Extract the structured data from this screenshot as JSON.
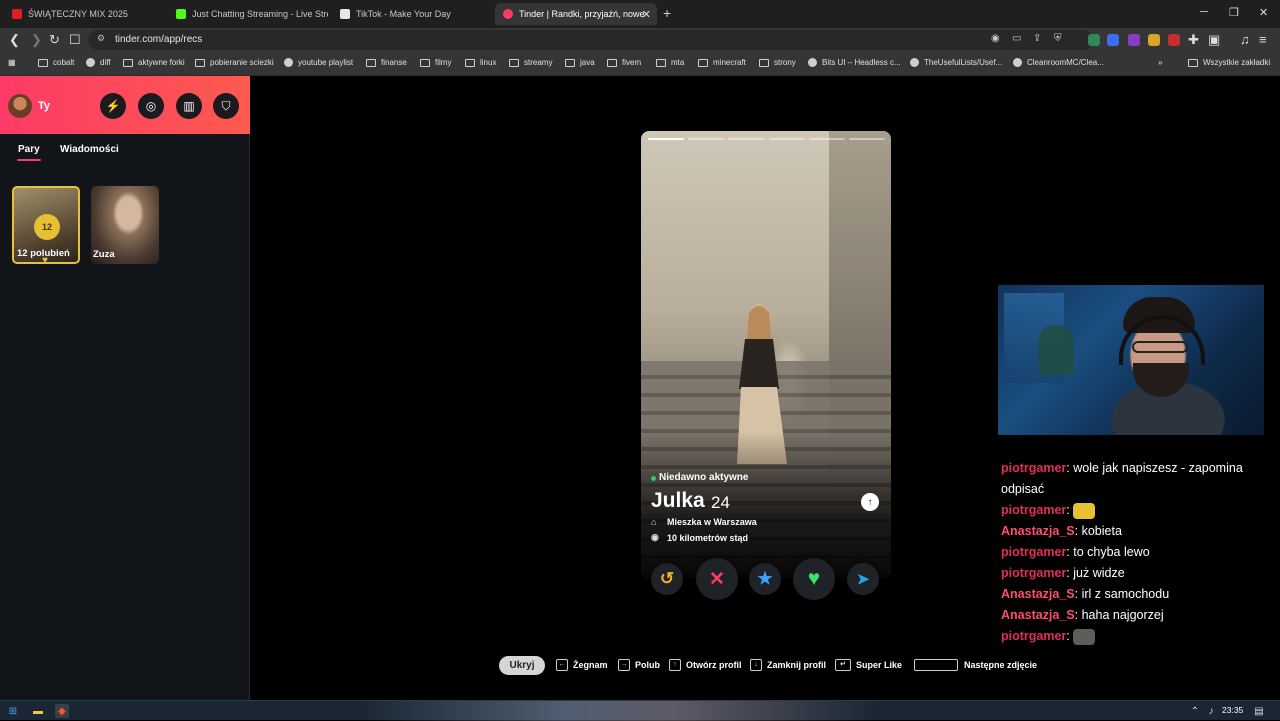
{
  "browser": {
    "tabs": [
      {
        "title": "ŚWIĄTECZNY MIX 2025",
        "fav_color": "#e02020",
        "active": false
      },
      {
        "title": "Just Chatting Streaming - Live Stream",
        "fav_color": "#53fc18",
        "active": false
      },
      {
        "title": "TikTok - Make Your Day",
        "fav_color": "#e8e8e8",
        "active": false
      },
      {
        "title": "Tinder | Randki, przyjaźń, nowe z",
        "fav_color": "#fd3a68",
        "active": true
      }
    ],
    "new_tab": "+",
    "window_controls": {
      "minimize": "─",
      "restore": "❐",
      "close": "✕"
    },
    "url": "tinder.com/app/recs",
    "bookmarks": [
      {
        "label": "cobalt",
        "icon": "cobalt-icon"
      },
      {
        "label": "diff",
        "icon": "diff-icon"
      },
      {
        "label": "aktywne forki",
        "icon": "fork-icon"
      },
      {
        "label": "pobieranie sciezki",
        "icon": "download-icon"
      },
      {
        "label": "youtube playlist",
        "icon": "globe-icon"
      },
      {
        "label": "finanse",
        "icon": "folder-icon"
      },
      {
        "label": "filmy",
        "icon": "folder-icon"
      },
      {
        "label": "linux",
        "icon": "folder-icon"
      },
      {
        "label": "streamy",
        "icon": "folder-icon"
      },
      {
        "label": "java",
        "icon": "folder-icon"
      },
      {
        "label": "fivem",
        "icon": "folder-icon"
      },
      {
        "label": "mta",
        "icon": "folder-icon"
      },
      {
        "label": "minecraft",
        "icon": "folder-icon"
      },
      {
        "label": "strony",
        "icon": "folder-icon"
      },
      {
        "label": "Bits UI – Headless c...",
        "icon": "dot-icon"
      },
      {
        "label": "TheUsefulLists/Usef...",
        "icon": "github-icon"
      },
      {
        "label": "CleanroomMC/Clea...",
        "icon": "github-icon"
      }
    ],
    "bookmarks_more": "»",
    "all_bookmarks": "Wszystkie zakładki"
  },
  "sidebar": {
    "me_label": "Ty",
    "tabs": {
      "matches": "Pary",
      "messages": "Wiadomości"
    },
    "likes": {
      "count": "12",
      "label": "12 polubień"
    },
    "matches": [
      {
        "name": "Zuza"
      }
    ]
  },
  "profile": {
    "status": "Niedawno aktywne",
    "name": "Julka",
    "age": "24",
    "lives_in": "Mieszka w Warszawa",
    "distance": "10 kilometrów stąd",
    "photo_count": 6,
    "current_photo": 1
  },
  "actions": {
    "rewind": "↺",
    "nope": "✕",
    "super_like": "★",
    "like": "♥",
    "boost": "➤"
  },
  "shortcuts": {
    "hide": "Ukryj",
    "nope": "Żegnam",
    "like": "Polub",
    "open_profile": "Otwórz profil",
    "close_profile": "Zamknij profil",
    "super_like": "Super Like",
    "next_photo": "Następne zdjęcie"
  },
  "chat": [
    {
      "user": "piotrgamer",
      "color": "#e0305a",
      "text": "wole jak napiszesz - zapomina"
    },
    {
      "user": "",
      "color": "#e0305a",
      "text": "odpisać"
    },
    {
      "user": "piotrgamer",
      "color": "#e0305a",
      "text": "",
      "emote": "#e7c133"
    },
    {
      "user": "Anastazja_S",
      "color": "#ff4d6d",
      "text": "kobieta"
    },
    {
      "user": "piotrgamer",
      "color": "#e0305a",
      "text": "to chyba lewo"
    },
    {
      "user": "piotrgamer",
      "color": "#e0305a",
      "text": "już widze"
    },
    {
      "user": "Anastazja_S",
      "color": "#ff4d6d",
      "text": "irl z samochodu"
    },
    {
      "user": "Anastazja_S",
      "color": "#ff4d6d",
      "text": "haha najgorzej"
    },
    {
      "user": "piotrgamer",
      "color": "#e0305a",
      "text": "",
      "emote": "#5a5f58"
    }
  ],
  "taskbar": {
    "time": "23:35"
  },
  "colors": {
    "brand": "#fd3a68",
    "gold": "#e7c133",
    "nope": "#fd3a68",
    "super": "#3ca4ff",
    "like": "#3ee06c",
    "boost": "#2aa0f0",
    "rewind": "#f5b02a"
  }
}
